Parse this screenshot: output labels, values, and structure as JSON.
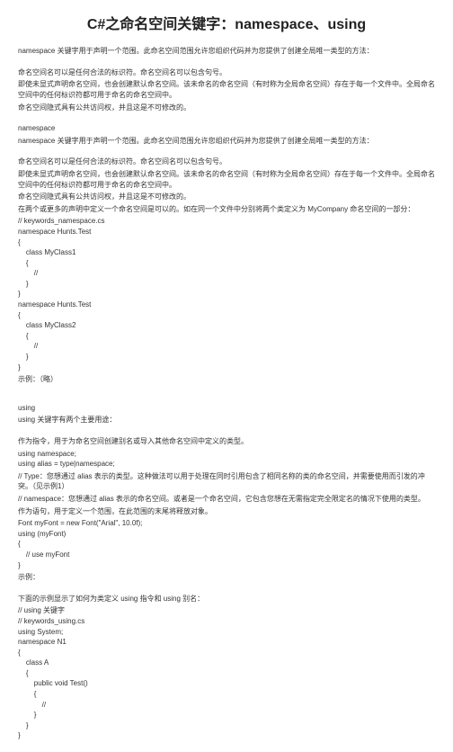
{
  "title": "C#之命名空间关键字：namespace、using",
  "intro": "namespace 关键字用于声明一个范围。此命名空间范围允许您组织代码并为您提供了创建全局唯一类型的方法：",
  "p1": "命名空间名可以是任何合法的标识符。命名空间名可以包含句号。",
  "p2": "即使未显式声明命名空间，也会创建默认命名空间。该未命名的命名空间（有时称为全局命名空间）存在于每一个文件中。全局命名空间中的任何标识符都可用于命名的命名空间中。",
  "p3": "命名空间隐式具有公共访问权，并且这是不可修改的。",
  "ns_header": "namespace",
  "ns_intro": "namespace 关键字用于声明一个范围。此命名空间范围允许您组织代码并为您提供了创建全局唯一类型的方法：",
  "ns_p1": "命名空间名可以是任何合法的标识符。命名空间名可以包含句号。",
  "ns_p2": "即使未显式声明命名空间，也会创建默认命名空间。该未命名的命名空间（有时称为全局命名空间）存在于每一个文件中。全局命名空间中的任何标识符都可用于命名的命名空间中。",
  "ns_p3": "命名空间隐式具有公共访问权，并且这是不可修改的。",
  "ns_p4": "在两个或更多的声明中定义一个命名空间是可以的。如在同一个文件中分别将两个类定义为 MyCompany 命名空间的一部分：",
  "code1": [
    "// keywords_namespace.cs",
    "namespace Hunts.Test",
    "{",
    "    class MyClass1",
    "    {",
    "        //",
    "    }",
    "}",
    "",
    "namespace Hunts.Test",
    "{",
    "    class MyClass2",
    "    {",
    "        //",
    "    }",
    "}"
  ],
  "example_label": "示例：（略）",
  "using_header": "using",
  "using_intro": "using 关键字有两个主要用途：",
  "using_p1": "作为指令，用于为命名空间创建别名或导入其他命名空间中定义的类型。",
  "code2": [
    "using namespace;",
    "using alias = type|namespace;"
  ],
  "using_c1": "// Type：您想通过 alias 表示的类型。这种做法可以用于处理在同时引用包含了相同名称的类的命名空间，并需要使用而引发的冲突。（见示例1）",
  "using_c2": "// namespace：您想通过 alias 表示的命名空间。或者是一个命名空间，它包含您想在无需指定完全限定名的情况下使用的类型。",
  "using_p2": "作为语句，用于定义一个范围，在此范围的末尾将释放对象。",
  "code3": [
    "Font myFont = new Font(\"Arial\", 10.0f);",
    "using (myFont)",
    "{",
    "    // use myFont",
    "}"
  ],
  "example2": "示例：",
  "using_p3": "下面的示例显示了如何为类定义 using 指令和 using 别名：",
  "code4": [
    "// using 关键字",
    "// keywords_using.cs",
    "using System;",
    "namespace N1",
    "{",
    "    class A",
    "    {",
    "        public void Test()",
    "        {",
    "            //",
    "        }",
    "    }",
    "}"
  ]
}
